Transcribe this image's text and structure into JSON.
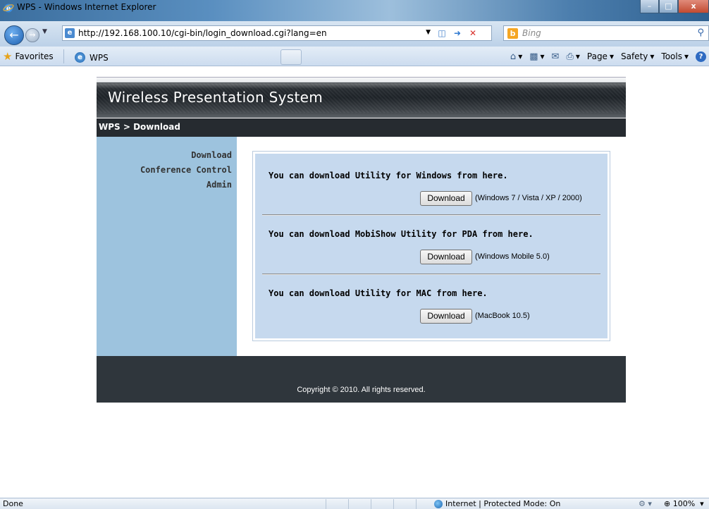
{
  "window": {
    "title": "WPS - Windows Internet Explorer",
    "minimize": "–",
    "maximize": "□",
    "close": "x"
  },
  "address": {
    "url": "http://192.168.100.10/cgi-bin/login_download.cgi?lang=en",
    "search_placeholder": "Bing"
  },
  "favorites_bar": {
    "favorites_label": "Favorites",
    "tab_title": "WPS",
    "commands": {
      "page": "Page",
      "safety": "Safety",
      "tools": "Tools"
    }
  },
  "wps": {
    "banner_title": "Wireless Presentation System",
    "breadcrumb": "WPS > Download",
    "sidebar": [
      {
        "label": "Download"
      },
      {
        "label": "Conference Control"
      },
      {
        "label": "Admin"
      }
    ],
    "downloads": [
      {
        "text": "You can download Utility for Windows from here.",
        "button": "Download",
        "note": "(Windows 7 / Vista / XP / 2000)"
      },
      {
        "text": "You can download MobiShow Utility for PDA from here.",
        "button": "Download",
        "note": "(Windows Mobile 5.0)"
      },
      {
        "text": "You can download Utility for MAC from here.",
        "button": "Download",
        "note": "(MacBook 10.5)"
      }
    ],
    "copyright": "Copyright © 2010. All rights reserved."
  },
  "status": {
    "text": "Done",
    "zone": "Internet | Protected Mode: On",
    "zoom": "100%"
  },
  "colors": {
    "sidebar_bg": "#9dc3de",
    "panel_bg": "#c6d9ee",
    "header_dark": "#262b30",
    "footer_bg": "#2f363c"
  }
}
